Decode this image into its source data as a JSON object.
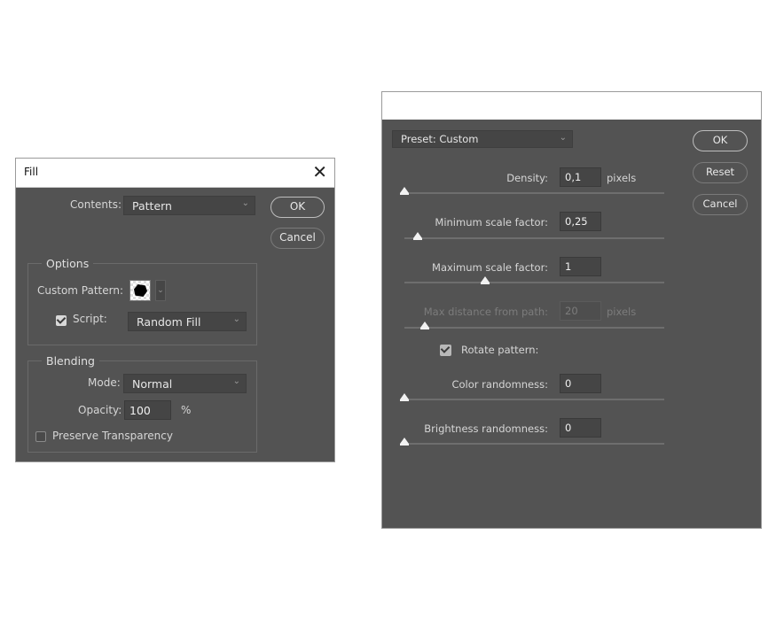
{
  "fill_dialog": {
    "title": "Fill",
    "close_glyph": "✕",
    "contents_label": "Contents:",
    "contents_value": "Pattern",
    "ok_label": "OK",
    "cancel_label": "Cancel",
    "options": {
      "group_label": "Options",
      "custom_pattern_label": "Custom Pattern:",
      "script_checked": true,
      "script_label": "Script:",
      "script_value": "Random Fill"
    },
    "blending": {
      "group_label": "Blending",
      "mode_label": "Mode:",
      "mode_value": "Normal",
      "opacity_label": "Opacity:",
      "opacity_value": "100",
      "opacity_unit": "%",
      "preserve_transparency_checked": false,
      "preserve_transparency_label": "Preserve Transparency"
    }
  },
  "random_fill_dialog": {
    "preset_value": "Preset: Custom",
    "ok_label": "OK",
    "reset_label": "Reset",
    "cancel_label": "Cancel",
    "rotate_pattern_checked": true,
    "rotate_pattern_label": "Rotate pattern:",
    "fields": [
      {
        "label": "Density:",
        "value": "0,1",
        "unit": "pixels",
        "slider_fraction": 0.0,
        "disabled": false
      },
      {
        "label": "Minimum scale factor:",
        "value": "0,25",
        "unit": "",
        "slider_fraction": 0.05,
        "disabled": false
      },
      {
        "label": "Maximum scale factor:",
        "value": "1",
        "unit": "",
        "slider_fraction": 0.31,
        "disabled": false
      },
      {
        "label": "Max distance from path:",
        "value": "20",
        "unit": "pixels",
        "slider_fraction": 0.08,
        "disabled": true
      },
      {
        "label": "Color randomness:",
        "value": "0",
        "unit": "",
        "slider_fraction": 0.0,
        "disabled": false
      },
      {
        "label": "Brightness randomness:",
        "value": "0",
        "unit": "",
        "slider_fraction": 0.0,
        "disabled": false
      }
    ]
  }
}
